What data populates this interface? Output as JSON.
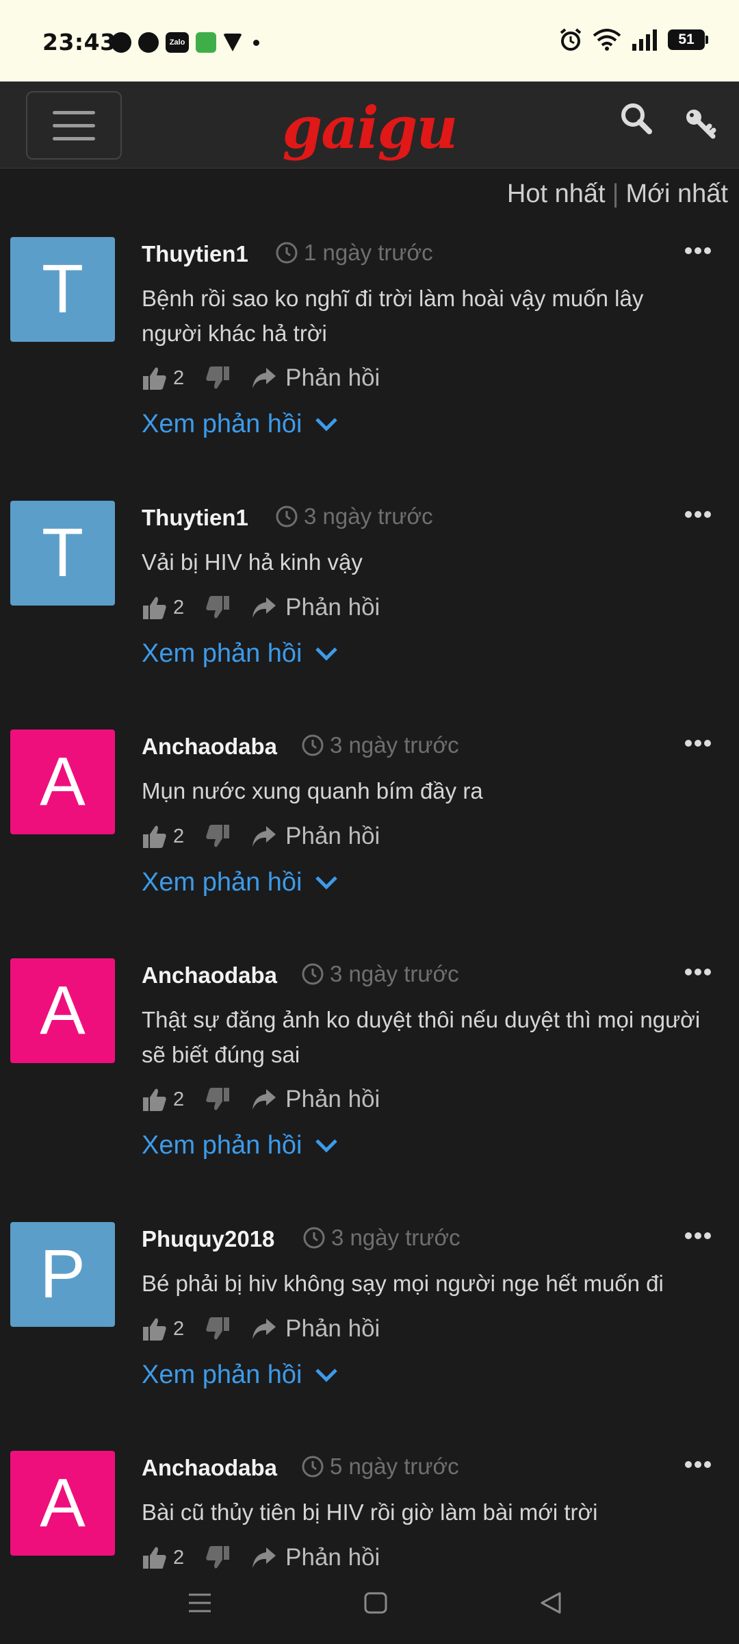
{
  "status_bar": {
    "time": "23:43",
    "notification_icons": [
      "messenger-icon",
      "globe-icon",
      "zalo-icon",
      "app-icon",
      "shield-icon",
      "dot"
    ],
    "zalo_label": "Zalo",
    "battery": "51"
  },
  "header": {
    "logo": "gaigu",
    "logo_color": "#e01818"
  },
  "sort": {
    "hot": "Hot nhất",
    "separator": "|",
    "newest": "Mới nhất"
  },
  "comments": [
    {
      "avatar_letter": "T",
      "avatar_color": "#5b9ec9",
      "author": "Thuytien1",
      "time": "1 ngày trước",
      "text": "Bệnh rồi sao ko nghĩ đi trời làm hoài vậy muốn lây người khác hả trời",
      "likes": "2",
      "reply_label": "Phản hồi",
      "view_replies": "Xem phản hồi"
    },
    {
      "avatar_letter": "T",
      "avatar_color": "#5b9ec9",
      "author": "Thuytien1",
      "time": "3 ngày trước",
      "text": "Vải bị HIV hả kinh vậy",
      "likes": "2",
      "reply_label": "Phản hồi",
      "view_replies": "Xem phản hồi"
    },
    {
      "avatar_letter": "A",
      "avatar_color": "#ef0f7c",
      "author": "Anchaodaba",
      "time": "3 ngày trước",
      "text": "Mụn nước xung quanh bím đầy ra",
      "likes": "2",
      "reply_label": "Phản hồi",
      "view_replies": "Xem phản hồi"
    },
    {
      "avatar_letter": "A",
      "avatar_color": "#ef0f7c",
      "author": "Anchaodaba",
      "time": "3 ngày trước",
      "text": "Thật sự đăng ảnh ko duyệt thôi nếu duyệt thì mọi người sẽ biết đúng sai",
      "likes": "2",
      "reply_label": "Phản hồi",
      "view_replies": "Xem phản hồi"
    },
    {
      "avatar_letter": "P",
      "avatar_color": "#5b9ec9",
      "author": "Phuquy2018",
      "time": "3 ngày trước",
      "text": "Bé phải bị hiv không sạy mọi người nge hết muốn đi",
      "likes": "2",
      "reply_label": "Phản hồi",
      "view_replies": "Xem phản hồi"
    },
    {
      "avatar_letter": "A",
      "avatar_color": "#ef0f7c",
      "author": "Anchaodaba",
      "time": "5 ngày trước",
      "text": "Bài cũ thủy tiên bị HIV rồi giờ làm bài mới trời",
      "likes": "2",
      "reply_label": "Phản hồi",
      "view_replies": ""
    }
  ],
  "nav": [
    "recent-apps-icon",
    "home-icon",
    "back-icon"
  ]
}
